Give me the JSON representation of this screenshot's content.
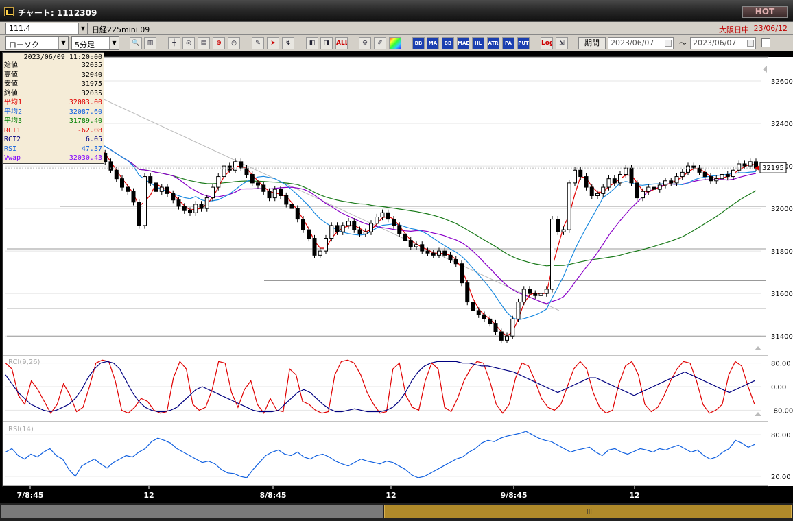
{
  "window": {
    "title": "チャート: 1112309",
    "hot_label": "HOT"
  },
  "header": {
    "symbol_code": "111.4",
    "symbol_name": "日経225mini 09",
    "session": "大阪日中",
    "date": "23/06/12"
  },
  "toolbar": {
    "chart_type": "ローソク",
    "interval": "5分足",
    "buttons": [
      "zoom-search",
      "ruler",
      "candle",
      "volume",
      "bars",
      "target",
      "clock",
      "pen",
      "cursor",
      "bolt",
      "step1",
      "step2",
      "ALL",
      "gear",
      "pencil",
      "palette",
      "BB1",
      "MA",
      "BB",
      "MAE",
      "HL",
      "ATR",
      "PARA",
      "PUT",
      "Log",
      "export"
    ],
    "button_labels": {
      "all": "ALL",
      "bb1": "BB",
      "ma": "MA",
      "bb": "BB",
      "mae": "MAE",
      "hl": "HL",
      "atr": "ATR",
      "para": "PA RA",
      "put": "PUT",
      "log": "Log"
    },
    "period_label": "期間",
    "start_date": "2023/06/07",
    "tilde": "〜",
    "end_date": "2023/06/07"
  },
  "info_panel": {
    "datetime": "2023/06/09  11:20:00",
    "rows": [
      {
        "label": "始値",
        "value": "32035",
        "color": "#000000"
      },
      {
        "label": "高値",
        "value": "32040",
        "color": "#000000"
      },
      {
        "label": "安値",
        "value": "31975",
        "color": "#000000"
      },
      {
        "label": "終値",
        "value": "32035",
        "color": "#000000"
      },
      {
        "label": "平均1",
        "value": "32083.00",
        "color": "#e00000"
      },
      {
        "label": "平均2",
        "value": "32087.60",
        "color": "#1060e0"
      },
      {
        "label": "平均3",
        "value": "31789.40",
        "color": "#008000"
      },
      {
        "label": "RCI1",
        "value": "-62.08",
        "color": "#e00000"
      },
      {
        "label": "RCI2",
        "value": "6.05",
        "color": "#000080"
      },
      {
        "label": "RSI",
        "value": "47.37",
        "color": "#1060e0"
      },
      {
        "label": "Vwap",
        "value": "32030.43",
        "color": "#8000ff"
      }
    ]
  },
  "chart_data": [
    {
      "type": "candlestick",
      "y_ticks": [
        "32600",
        "32400",
        "32200",
        "32000",
        "31800",
        "31600",
        "31400"
      ],
      "ylim": [
        31320,
        32700
      ],
      "last_price_label": "32195",
      "x_ticks": [
        "7/8:45",
        "12",
        "8/8:45",
        "12",
        "9/8:45",
        "12"
      ],
      "price_path": [
        32290,
        32350,
        32340,
        32290,
        32260,
        32220,
        32180,
        32140,
        32100,
        32080,
        32030,
        31920,
        32150,
        32120,
        32080,
        32100,
        32070,
        32040,
        32010,
        31990,
        31980,
        32020,
        32000,
        32050,
        32100,
        32150,
        32200,
        32180,
        32220,
        32190,
        32160,
        32120,
        32110,
        32080,
        32050,
        32090,
        32060,
        32020,
        32000,
        31950,
        31900,
        31860,
        31780,
        31800,
        31860,
        31920,
        31890,
        31920,
        31940,
        31900,
        31880,
        31890,
        31930,
        31960,
        31980,
        31950,
        31920,
        31880,
        31850,
        31820,
        31830,
        31800,
        31790,
        31780,
        31800,
        31780,
        31760,
        31740,
        31650,
        31560,
        31520,
        31500,
        31480,
        31460,
        31420,
        31380,
        31400,
        31480,
        31560,
        31620,
        31600,
        31590,
        31600,
        31620,
        31950,
        31890,
        31900,
        32120,
        32180,
        32150,
        32100,
        32060,
        32070,
        32100,
        32140,
        32120,
        32160,
        32190,
        32120,
        32050,
        32080,
        32100,
        32090,
        32110,
        32130,
        32120,
        32150,
        32170,
        32200,
        32190,
        32170,
        32150,
        32130,
        32140,
        32160,
        32150,
        32180,
        32210,
        32200,
        32220,
        32190
      ]
    },
    {
      "type": "line",
      "title": "RCI(9,26)",
      "y_ticks": [
        "80.00",
        "0.00",
        "-80.00"
      ],
      "ylim": [
        -100,
        100
      ],
      "series": [
        {
          "color": "#e00000",
          "values": [
            80,
            60,
            -30,
            -60,
            20,
            -10,
            -50,
            -90,
            -60,
            10,
            -30,
            -85,
            -70,
            0,
            80,
            90,
            85,
            20,
            -80,
            -90,
            -70,
            -40,
            -50,
            -80,
            -90,
            -85,
            30,
            85,
            60,
            -60,
            -80,
            -70,
            -10,
            85,
            80,
            -20,
            -70,
            -10,
            20,
            -60,
            -90,
            -40,
            -80,
            -85,
            60,
            40,
            -50,
            -60,
            -80,
            -90,
            -85,
            40,
            85,
            90,
            80,
            40,
            -20,
            -60,
            -90,
            -85,
            60,
            80,
            -30,
            -70,
            -80,
            20,
            80,
            60,
            -70,
            -85,
            -40,
            20,
            60,
            85,
            80,
            20,
            -60,
            -90,
            -60,
            30,
            80,
            70,
            20,
            -40,
            -70,
            -80,
            -60,
            0,
            60,
            85,
            60,
            -20,
            -70,
            -90,
            -80,
            10,
            70,
            85,
            40,
            -60,
            -85,
            -70,
            -30,
            20,
            60,
            85,
            80,
            20,
            -60,
            -90,
            -80,
            -60,
            40,
            85,
            70,
            0,
            -60
          ]
        },
        {
          "color": "#000080",
          "values": [
            40,
            10,
            -20,
            -40,
            -60,
            -70,
            -80,
            -85,
            -80,
            -70,
            -60,
            -40,
            -10,
            30,
            60,
            80,
            85,
            80,
            60,
            20,
            -20,
            -50,
            -70,
            -80,
            -85,
            -85,
            -80,
            -70,
            -50,
            -30,
            -10,
            0,
            -10,
            -20,
            -30,
            -40,
            -50,
            -60,
            -70,
            -80,
            -85,
            -85,
            -85,
            -80,
            -60,
            -40,
            -20,
            -10,
            -20,
            -40,
            -60,
            -75,
            -85,
            -85,
            -80,
            -75,
            -80,
            -85,
            -85,
            -85,
            -80,
            -70,
            -50,
            -20,
            20,
            50,
            70,
            80,
            85,
            85,
            85,
            85,
            80,
            80,
            75,
            70,
            70,
            65,
            60,
            55,
            50,
            40,
            30,
            20,
            10,
            0,
            -10,
            -20,
            -10,
            0,
            10,
            20,
            30,
            30,
            20,
            10,
            0,
            -10,
            -20,
            -30,
            -20,
            -10,
            0,
            10,
            20,
            30,
            40,
            50,
            40,
            30,
            20,
            10,
            0,
            -10,
            -20,
            -10,
            0,
            10,
            20
          ]
        }
      ]
    },
    {
      "type": "line",
      "title": "RSI(14)",
      "y_ticks": [
        "80.00",
        "20.00"
      ],
      "ylim": [
        10,
        95
      ],
      "series": [
        {
          "color": "#1060e0",
          "values": [
            55,
            60,
            50,
            45,
            52,
            48,
            55,
            60,
            50,
            45,
            30,
            20,
            35,
            40,
            45,
            38,
            32,
            40,
            45,
            50,
            48,
            55,
            60,
            70,
            75,
            72,
            68,
            60,
            55,
            50,
            45,
            40,
            42,
            38,
            30,
            25,
            24,
            20,
            18,
            30,
            40,
            50,
            55,
            58,
            52,
            50,
            55,
            48,
            45,
            50,
            52,
            48,
            42,
            38,
            35,
            40,
            45,
            42,
            40,
            38,
            42,
            40,
            35,
            30,
            22,
            18,
            20,
            25,
            30,
            35,
            40,
            45,
            48,
            55,
            60,
            68,
            72,
            70,
            75,
            78,
            80,
            82,
            85,
            80,
            75,
            72,
            70,
            65,
            60,
            55,
            58,
            60,
            62,
            55,
            50,
            58,
            60,
            55,
            52,
            56,
            60,
            58,
            55,
            60,
            58,
            62,
            65,
            60,
            55,
            58,
            50,
            45,
            48,
            55,
            60,
            72,
            68,
            62,
            66
          ]
        }
      ]
    }
  ]
}
